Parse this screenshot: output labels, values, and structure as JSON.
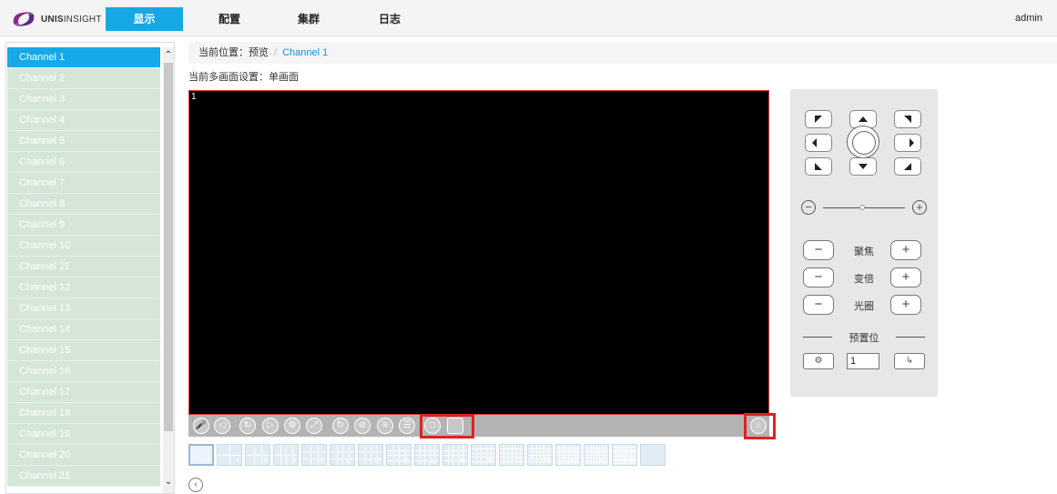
{
  "header": {
    "brand_bold": "UNIS",
    "brand_rest": "INSIGHT",
    "nav": [
      {
        "label": "显示",
        "active": true
      },
      {
        "label": "配置",
        "active": false
      },
      {
        "label": "集群",
        "active": false
      },
      {
        "label": "日志",
        "active": false
      }
    ],
    "user": "admin",
    "accent": "#18a7e6"
  },
  "sidebar": {
    "channels": [
      "Channel 1",
      "Channel 2",
      "Channel 3",
      "Channel 4",
      "Channel 5",
      "Channel 6",
      "Channel 7",
      "Channel 8",
      "Channel 9",
      "Channel 10",
      "Channel 11",
      "Channel 12",
      "Channel 13",
      "Channel 14",
      "Channel 15",
      "Channel 16",
      "Channel 17",
      "Channel 18",
      "Channel 19",
      "Channel 20",
      "Channel 21"
    ],
    "selected_index": 0
  },
  "breadcrumb": {
    "prefix": "当前位置：",
    "root": "预览",
    "separator": "/",
    "current": "Channel 1"
  },
  "split": {
    "label": "当前多画面设置：",
    "value": "单画面"
  },
  "video": {
    "window_number": "1"
  },
  "controls": {
    "icons": [
      "mic-icon",
      "volume-icon",
      "loop-icon",
      "play-icon",
      "snapshot-settings-icon",
      "fullscreen-expand-icon",
      "loop-all-icon",
      "stop-loop-icon",
      "stream-switch-icon",
      "stream-list-icon",
      "window-zoom-icon",
      "window-restore-icon"
    ],
    "right_icon": "light-bulb-icon"
  },
  "layouts": {
    "labels": [
      "1",
      "4",
      "6",
      "8",
      "9",
      "10",
      "13",
      "16",
      "17",
      "20",
      "25",
      "32",
      "36",
      "64",
      "80",
      "99",
      ""
    ],
    "selected_index": 0
  },
  "ptz": {
    "focus": "聚焦",
    "zoom": "变倍",
    "iris": "光圈",
    "preset": "预置位",
    "preset_value": "1",
    "minus": "−",
    "plus": "+"
  }
}
